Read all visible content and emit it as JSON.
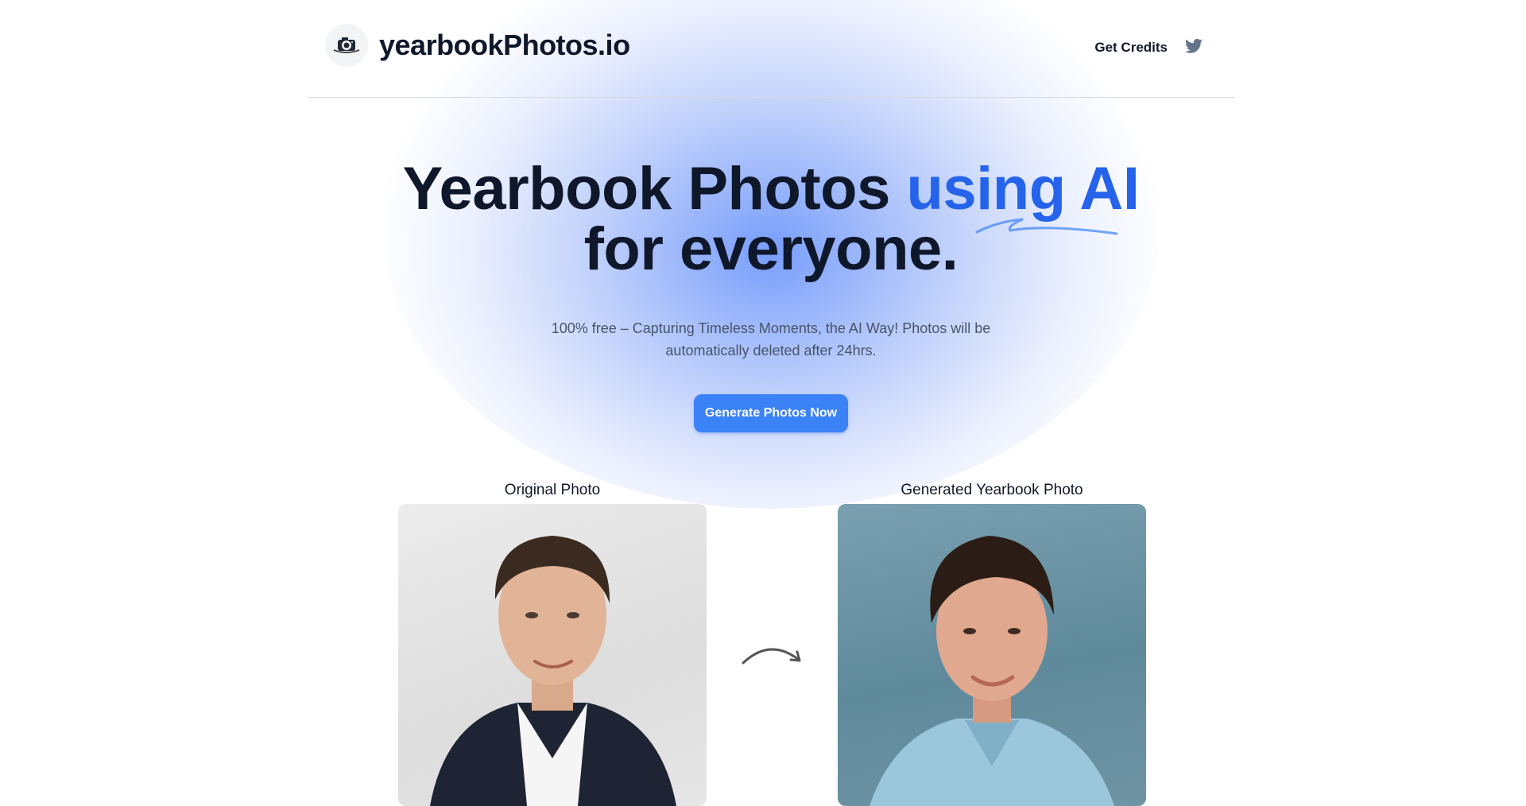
{
  "header": {
    "site_name": "yearbookPhotos.io",
    "logo_icon": "camera-icon",
    "nav": {
      "credits_label": "Get Credits",
      "twitter_icon": "twitter-icon"
    }
  },
  "hero": {
    "title_part1": "Yearbook Photos ",
    "title_accent": "using AI",
    "title_part2": "for everyone.",
    "subtitle": "100% free – Capturing Timeless Moments, the AI Way! Photos will be automatically deleted after 24hrs.",
    "cta_label": "Generate Photos Now"
  },
  "comparison": {
    "original_label": "Original Photo",
    "generated_label": "Generated Yearbook Photo",
    "arrow_icon": "curved-arrow-right-icon"
  },
  "colors": {
    "accent": "#2563eb",
    "button": "#3b82f6",
    "text": "#0f172a",
    "muted": "#475569"
  }
}
